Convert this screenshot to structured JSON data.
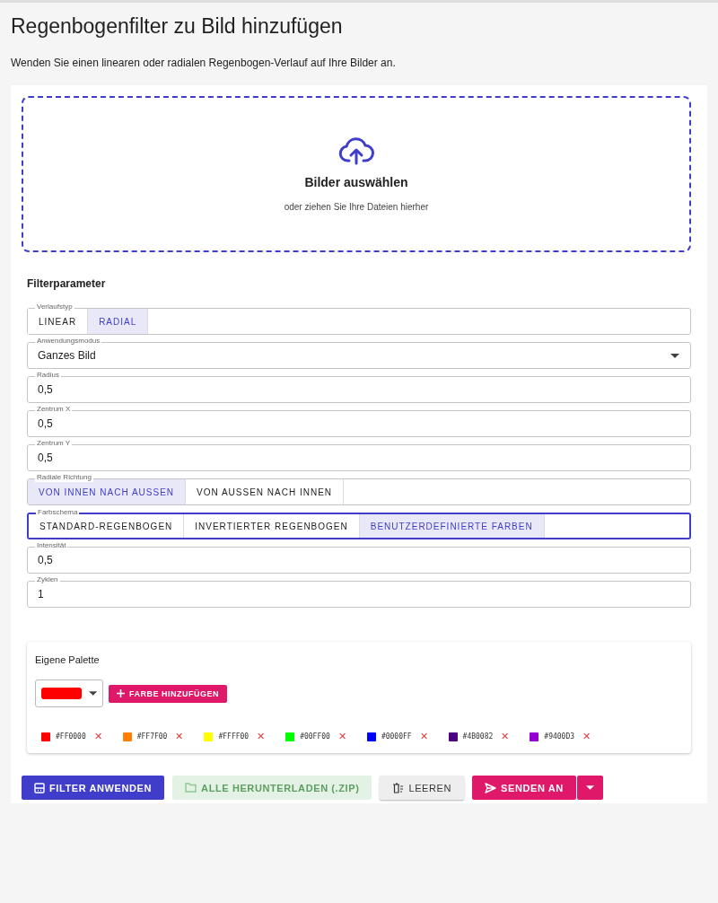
{
  "title": "Regenbogenfilter zu Bild hinzufügen",
  "subtitle": "Wenden Sie einen linearen oder radialen Regenbogen-Verlauf auf Ihre Bilder an.",
  "dropzone": {
    "title": "Bilder auswählen",
    "hint": "oder ziehen Sie Ihre Dateien hierher"
  },
  "section_title": "Filterparameter",
  "fields": [
    {
      "kind": "toggle",
      "label": "Verlaufstyp",
      "focused": false,
      "options": [
        {
          "label": "LINEAR",
          "selected": false
        },
        {
          "label": "RADIAL",
          "selected": true
        }
      ]
    },
    {
      "kind": "select",
      "label": "Anwendungsmodus",
      "value": "Ganzes Bild"
    },
    {
      "kind": "text",
      "label": "Radius",
      "value": "0,5"
    },
    {
      "kind": "text",
      "label": "Zentrum X",
      "value": "0,5"
    },
    {
      "kind": "text",
      "label": "Zentrum Y",
      "value": "0,5"
    },
    {
      "kind": "toggle",
      "label": "Radiale Richtung",
      "focused": false,
      "options": [
        {
          "label": "VON INNEN NACH AUSSEN",
          "selected": true
        },
        {
          "label": "VON AUSSEN NACH INNEN",
          "selected": false
        }
      ]
    },
    {
      "kind": "toggle",
      "label": "Farbschema",
      "focused": true,
      "options": [
        {
          "label": "STANDARD-REGENBOGEN",
          "selected": false
        },
        {
          "label": "INVERTIERTER REGENBOGEN",
          "selected": false
        },
        {
          "label": "BENUTZERDEFINIERTE FARBEN",
          "selected": true
        }
      ]
    },
    {
      "kind": "text",
      "label": "Intensität",
      "value": "0,5"
    },
    {
      "kind": "text",
      "label": "Zyklen",
      "value": "1"
    }
  ],
  "palette": {
    "title": "Eigene Palette",
    "picker": {
      "color": "#ff0000"
    },
    "add_label": "FARBE HINZUFÜGEN",
    "colors": [
      {
        "code": "#FF0000",
        "color": "#ff0000",
        "remove": "✕"
      },
      {
        "code": "#FF7F00",
        "color": "#ff7f00",
        "remove": "✕"
      },
      {
        "code": "#FFFF00",
        "color": "#ffff00",
        "remove": "✕"
      },
      {
        "code": "#00FF00",
        "color": "#00ff00",
        "remove": "✕"
      },
      {
        "code": "#0000FF",
        "color": "#0000ff",
        "remove": "✕"
      },
      {
        "code": "#4B0082",
        "color": "#4b0082",
        "remove": "✕"
      },
      {
        "code": "#9400D3",
        "color": "#9400d3",
        "remove": "✕"
      }
    ]
  },
  "actions": [
    {
      "kind": "apply",
      "label": "FILTER ANWENDEN",
      "disabled": false
    },
    {
      "kind": "download",
      "label": "ALLE HERUNTERLADEN (.ZIP)",
      "disabled": true
    },
    {
      "kind": "clear",
      "label": "LEEREN",
      "disabled": false
    },
    {
      "kind": "send",
      "label": "SENDEN AN",
      "disabled": false
    }
  ]
}
